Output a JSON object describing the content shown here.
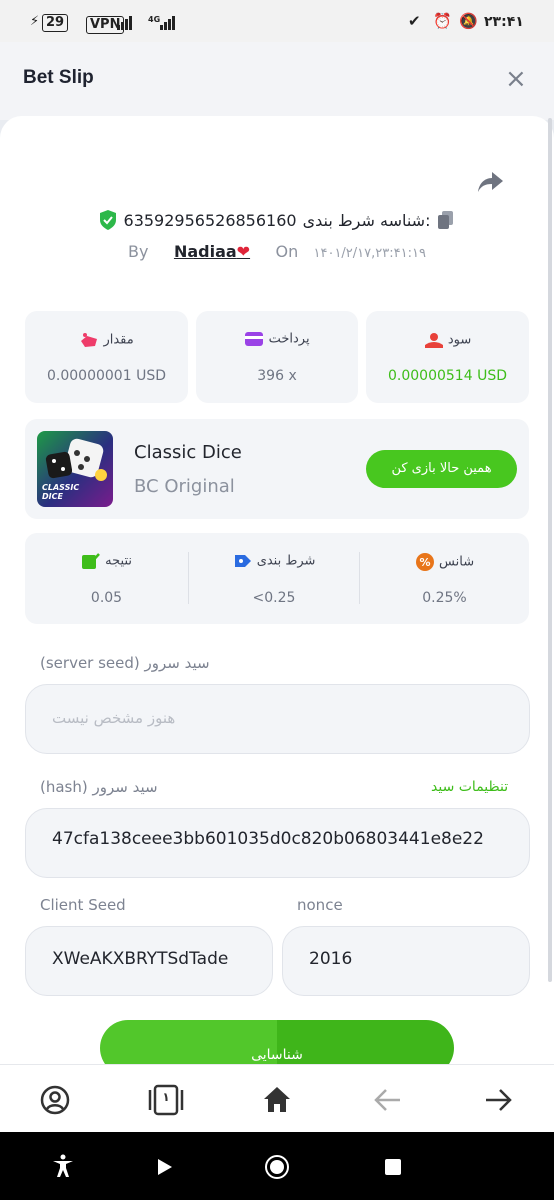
{
  "status_bar": {
    "battery": "29",
    "vpn": "VPN",
    "network": "4G",
    "time": "۲۳:۴۱"
  },
  "header": {
    "title": "Bet Slip",
    "close": "×"
  },
  "bet_info": {
    "id_label": "شناسه شرط بندی:",
    "id_value": "63592956526856160",
    "by_label": "By",
    "user": "Nadiaa",
    "on_label": "On",
    "date": "۱۴۰۱/۲/۱۷,۲۳:۴۱:۱۹"
  },
  "stats": {
    "profit_label": "سود",
    "profit_value": "0.00000514 USD",
    "payout_label": "پرداخت",
    "payout_value": "396 x",
    "amount_label": "مقدار",
    "amount_value": "0.00000001 USD"
  },
  "game": {
    "name": "Classic Dice",
    "provider": "BC Original",
    "thumb_text_1": "CLASSIC",
    "thumb_text_2": "DICE",
    "play_label": "همین حالا بازی کن"
  },
  "result": {
    "chance_label": "شانس",
    "chance_value": "0.25%",
    "bet_label": "شرط بندی",
    "bet_value": "<0.25",
    "result_label": "نتیجه",
    "result_value": "0.05"
  },
  "seeds": {
    "server_seed_label": "(server seed) سید سرور",
    "server_seed_placeholder": "هنوز مشخص نیست",
    "hash_label": "(hash) سید سرور",
    "seed_settings": "تنظیمات سید",
    "hash_value": "47cfa138ceee3bb601035d0c820b06803441e8e22",
    "client_seed_label": "Client Seed",
    "client_seed_value": "XWeAKXBRYTSdTade",
    "nonce_label": "nonce",
    "nonce_value": "2016",
    "verify_label": "شناسایی"
  },
  "colors": {
    "accent": "#48c71f",
    "profit": "#3ebd1a",
    "link": "#3ebd1a"
  },
  "icons": [
    "shield-check-icon",
    "copy-icon",
    "share-icon",
    "heart-icon",
    "profit-icon",
    "wallet-icon",
    "amount-icon",
    "percent-icon",
    "bet-icon",
    "result-icon"
  ],
  "bottom_nav": {
    "tab_count": "۱"
  }
}
